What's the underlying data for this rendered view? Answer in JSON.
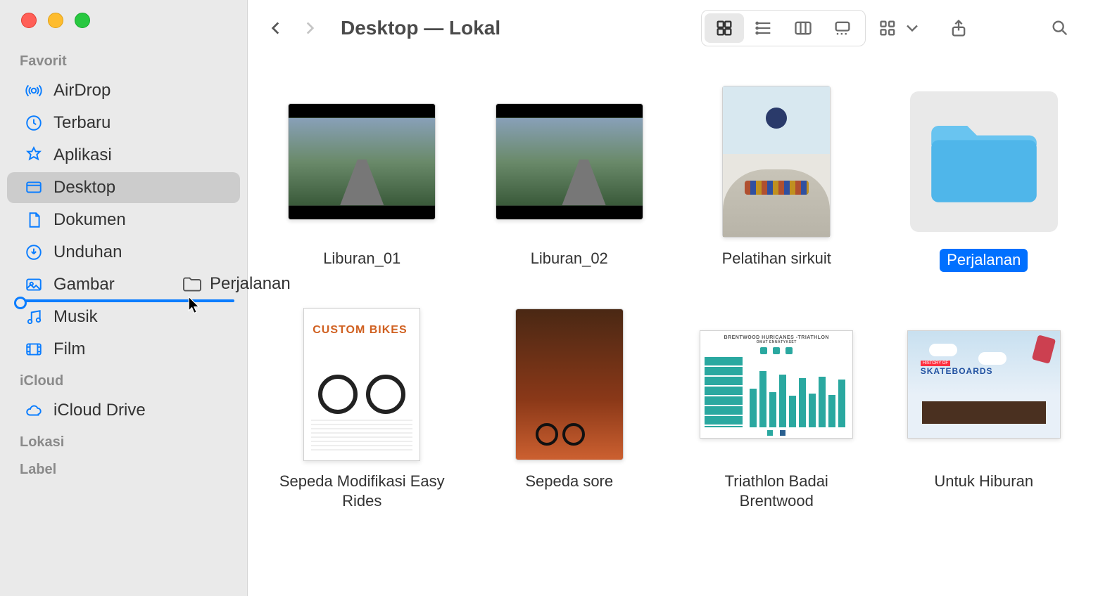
{
  "sidebar": {
    "sections": {
      "favorit": {
        "header": "Favorit",
        "items": [
          {
            "label": "AirDrop"
          },
          {
            "label": "Terbaru"
          },
          {
            "label": "Aplikasi"
          },
          {
            "label": "Desktop"
          },
          {
            "label": "Dokumen"
          },
          {
            "label": "Unduhan"
          },
          {
            "label": "Gambar"
          },
          {
            "label": "Musik"
          },
          {
            "label": "Film"
          }
        ]
      },
      "icloud": {
        "header": "iCloud",
        "items": [
          {
            "label": "iCloud Drive"
          }
        ]
      },
      "lokasi": {
        "header": "Lokasi"
      },
      "label": {
        "header": "Label"
      }
    }
  },
  "drag": {
    "label": "Perjalanan"
  },
  "toolbar": {
    "title": "Desktop — Lokal"
  },
  "files": [
    {
      "label": "Liburan_01"
    },
    {
      "label": "Liburan_02"
    },
    {
      "label": "Pelatihan sirkuit"
    },
    {
      "label": "Perjalanan",
      "selected": true
    },
    {
      "label": "Sepeda Modifikasi Easy Rides"
    },
    {
      "label": "Sepeda sore"
    },
    {
      "label": "Triathlon Badai Brentwood"
    },
    {
      "label": "Untuk Hiburan"
    }
  ],
  "chart_preview": {
    "title": "BRENTWOOD HURICANES -TRIATHLON",
    "subtitle": "OMAT ENNÄTYKSET"
  },
  "doc_preview": {
    "title": "CUSTOM BIKES"
  },
  "skate_preview": {
    "tag": "HISTORY OF",
    "word": "SKATEBOARDS"
  }
}
